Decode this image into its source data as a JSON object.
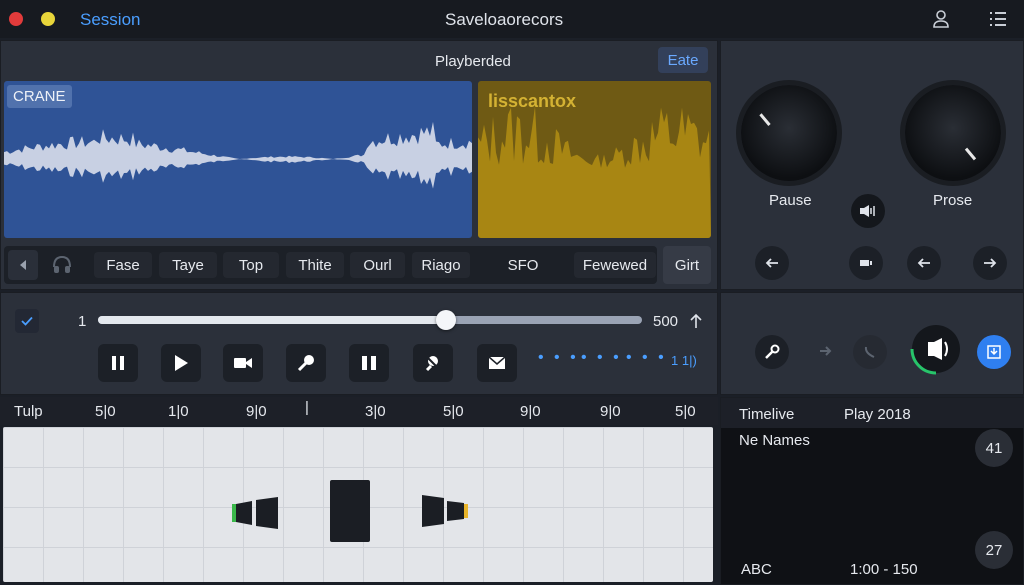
{
  "titlebar": {
    "app_label": "Session",
    "title": "Saveloaorecors"
  },
  "player": {
    "header": "Playberded",
    "header_button": "Eate",
    "track_blue_label": "CRANE",
    "track_gold_label": "lisscantox",
    "tabs": [
      "Fase",
      "Taye",
      "Top",
      "Thite",
      "Ourl",
      "Riago",
      "SFO",
      "Fewewed"
    ],
    "right_button": "Girt"
  },
  "knobs": {
    "left_label": "Pause",
    "right_label": "Prose"
  },
  "transport": {
    "slider_min": "1",
    "slider_max": "500",
    "slider_value": 0.64,
    "dots_label": "1 1|)"
  },
  "ruler": {
    "label": "Tulp",
    "ticks": [
      "5|0",
      "1|0",
      "9|0",
      "|",
      "3|0",
      "5|0",
      "9|0",
      "9|0",
      "5|0"
    ]
  },
  "timeline_panel": {
    "header_left": "Timelive",
    "header_right": "Play 2018",
    "name_label": "Ne Names",
    "badge_top": "41",
    "badge_bottom": "27",
    "footer_left": "ABC",
    "footer_right": "1:00 - 150"
  },
  "colors": {
    "accent": "#4a9eff",
    "wave_blue": "#2f5396",
    "wave_gold": "#a07e12",
    "ring_green": "#27c46a"
  }
}
